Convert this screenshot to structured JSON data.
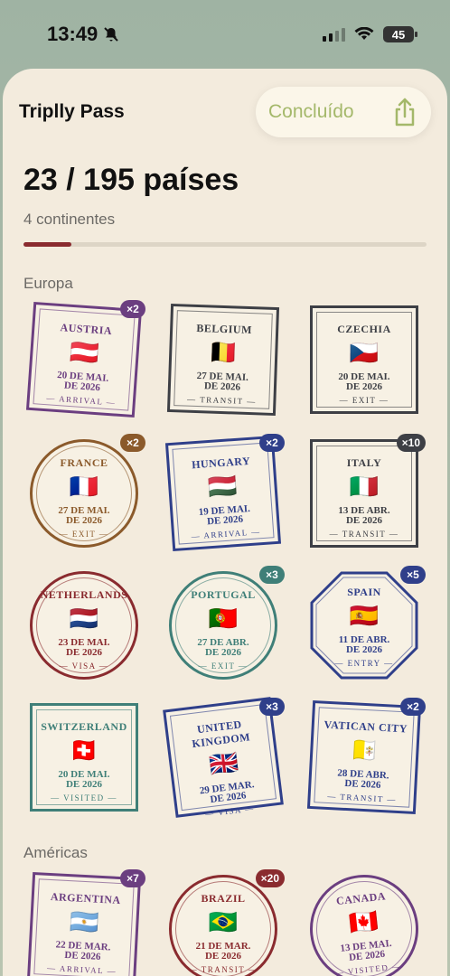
{
  "status": {
    "time": "13:49",
    "battery": "45"
  },
  "header": {
    "title": "Triplly Pass",
    "done": "Concluído"
  },
  "summary": {
    "count": "23 / 195 países",
    "continents": "4 continentes",
    "progress": 0.118
  },
  "sections": [
    {
      "title": "Europa"
    },
    {
      "title": "Américas"
    }
  ],
  "colors": {
    "purple": "#6b3e80",
    "slate": "#3d3f45",
    "brown": "#8b5a2b",
    "navy": "#2f3f8a",
    "maroon": "#8a2b2f",
    "teal": "#3f7f78",
    "accent": "#a4b86a"
  },
  "stamps": [
    {
      "name": "AUSTRIA",
      "flag": "🇦🇹",
      "date1": "20 DE MAI.",
      "date2": "DE 2026",
      "kind": "ARRIVAL",
      "badge": "×2",
      "color": "#6b3e80"
    },
    {
      "name": "BELGIUM",
      "flag": "🇧🇪",
      "date1": "27 DE MAI.",
      "date2": "DE 2026",
      "kind": "TRANSIT",
      "badge": "",
      "color": "#3d3f45"
    },
    {
      "name": "CZECHIA",
      "flag": "🇨🇿",
      "date1": "20 DE MAI.",
      "date2": "DE 2026",
      "kind": "EXIT",
      "badge": "",
      "color": "#3d3f45"
    },
    {
      "name": "FRANCE",
      "flag": "🇫🇷",
      "date1": "27 DE MAI.",
      "date2": "DE 2026",
      "kind": "EXIT",
      "badge": "×2",
      "color": "#8b5a2b"
    },
    {
      "name": "HUNGARY",
      "flag": "🇭🇺",
      "date1": "19 DE MAI.",
      "date2": "DE 2026",
      "kind": "ARRIVAL",
      "badge": "×2",
      "color": "#2f3f8a"
    },
    {
      "name": "ITALY",
      "flag": "🇮🇹",
      "date1": "13 DE ABR.",
      "date2": "DE 2026",
      "kind": "TRANSIT",
      "badge": "×10",
      "color": "#3d3f45"
    },
    {
      "name": "NETHERLANDS",
      "flag": "🇳🇱",
      "date1": "23 DE MAI.",
      "date2": "DE 2026",
      "kind": "VISA",
      "badge": "",
      "color": "#8a2b2f"
    },
    {
      "name": "PORTUGAL",
      "flag": "🇵🇹",
      "date1": "27 DE ABR.",
      "date2": "DE 2026",
      "kind": "EXIT",
      "badge": "×3",
      "color": "#3f7f78"
    },
    {
      "name": "SPAIN",
      "flag": "🇪🇸",
      "date1": "11 DE ABR.",
      "date2": "DE 2026",
      "kind": "ENTRY",
      "badge": "×5",
      "color": "#2f3f8a"
    },
    {
      "name": "SWITZERLAND",
      "flag": "🇨🇭",
      "date1": "20 DE MAI.",
      "date2": "DE 2026",
      "kind": "VISITED",
      "badge": "",
      "color": "#3f7f78"
    },
    {
      "name": "UNITED KINGDOM",
      "flag": "🇬🇧",
      "date1": "29 DE MAR.",
      "date2": "DE 2026",
      "kind": "VISA",
      "badge": "×3",
      "color": "#2f3f8a"
    },
    {
      "name": "VATICAN CITY",
      "flag": "🇻🇦",
      "date1": "28 DE ABR.",
      "date2": "DE 2026",
      "kind": "TRANSIT",
      "badge": "×2",
      "color": "#2f3f8a"
    },
    {
      "name": "ARGENTINA",
      "flag": "🇦🇷",
      "date1": "22 DE MAR.",
      "date2": "DE 2026",
      "kind": "ARRIVAL",
      "badge": "×7",
      "color": "#6b3e80"
    },
    {
      "name": "BRAZIL",
      "flag": "🇧🇷",
      "date1": "21 DE MAR.",
      "date2": "DE 2026",
      "kind": "TRANSIT",
      "badge": "×20",
      "color": "#8a2b2f"
    },
    {
      "name": "CANADA",
      "flag": "🇨🇦",
      "date1": "13 DE MAI.",
      "date2": "DE 2026",
      "kind": "VISITED",
      "badge": "",
      "color": "#6b3e80"
    }
  ]
}
